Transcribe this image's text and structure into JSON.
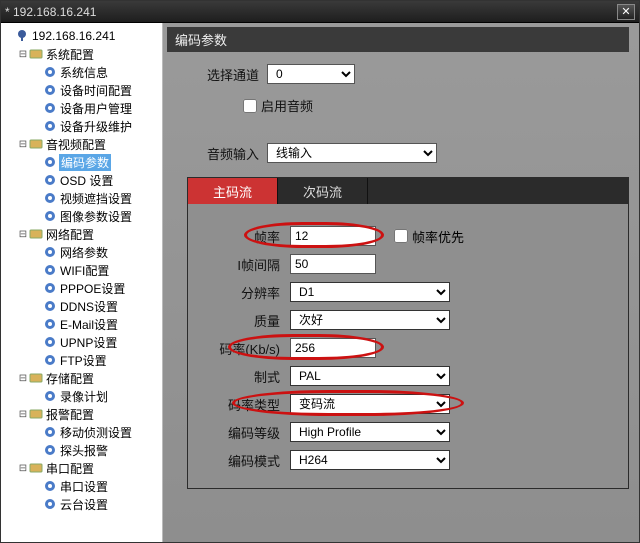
{
  "window": {
    "title": "* 192.168.16.241",
    "close": "✕"
  },
  "tree": {
    "root": "192.168.16.241",
    "groups": [
      {
        "label": "系统配置",
        "items": [
          "系统信息",
          "设备时间配置",
          "设备用户管理",
          "设备升级维护"
        ]
      },
      {
        "label": "音视频配置",
        "items": [
          "编码参数",
          "OSD 设置",
          "视频遮挡设置",
          "图像参数设置"
        ],
        "selected": 0
      },
      {
        "label": "网络配置",
        "items": [
          "网络参数",
          "WIFI配置",
          "PPPOE设置",
          "DDNS设置",
          "E-Mail设置",
          "UPNP设置",
          "FTP设置"
        ]
      },
      {
        "label": "存储配置",
        "items": [
          "录像计划"
        ]
      },
      {
        "label": "报警配置",
        "items": [
          "移动侦测设置",
          "探头报警"
        ]
      },
      {
        "label": "串口配置",
        "items": [
          "串口设置",
          "云台设置"
        ]
      }
    ]
  },
  "panel": {
    "title": "编码参数",
    "channel_label": "选择通道",
    "channel_value": "0",
    "enable_audio_label": "启用音频",
    "audio_input_label": "音频输入",
    "audio_input_value": "线输入"
  },
  "tabs": {
    "main": "主码流",
    "sub": "次码流"
  },
  "enc": {
    "fps_label": "帧率",
    "fps_value": "12",
    "fps_priority_label": "帧率优先",
    "iframe_label": "I帧间隔",
    "iframe_value": "50",
    "resolution_label": "分辨率",
    "resolution_value": "D1",
    "quality_label": "质量",
    "quality_value": "次好",
    "bitrate_label": "码率(Kb/s)",
    "bitrate_value": "256",
    "standard_label": "制式",
    "standard_value": "PAL",
    "ratetype_label": "码率类型",
    "ratetype_value": "变码流",
    "profile_label": "编码等级",
    "profile_value": "High Profile",
    "codec_label": "编码模式",
    "codec_value": "H264"
  },
  "colors": {
    "accent": "#c33",
    "highlight": "#c11"
  }
}
